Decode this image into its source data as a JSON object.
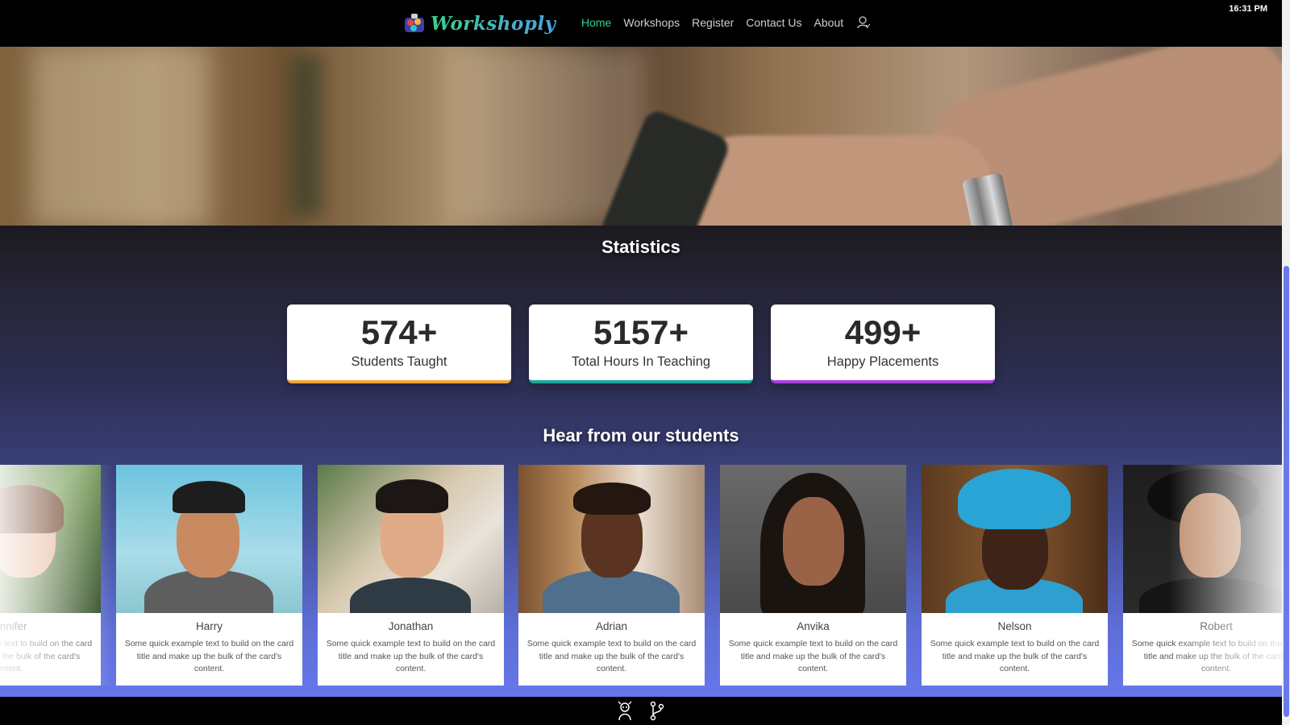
{
  "clock": "16:31 PM",
  "brand": {
    "name": "Workshoply",
    "logo_icon": "paint-palette-icon"
  },
  "nav": {
    "items": [
      {
        "label": "Home",
        "active": true
      },
      {
        "label": "Workshops",
        "active": false
      },
      {
        "label": "Register",
        "active": false
      },
      {
        "label": "Contact Us",
        "active": false
      },
      {
        "label": "About",
        "active": false
      }
    ],
    "user_icon": "user-icon"
  },
  "statistics": {
    "title": "Statistics",
    "cards": [
      {
        "value": "574+",
        "label": "Students Taught",
        "accent": "#f2a437"
      },
      {
        "value": "5157+",
        "label": "Total Hours In Teaching",
        "accent": "#16a89c"
      },
      {
        "value": "499+",
        "label": "Happy Placements",
        "accent": "#a83de0"
      }
    ]
  },
  "testimonials": {
    "title": "Hear from our students",
    "cards": [
      {
        "name": "Jennifer",
        "text": "Some quick example text to build on the card title and make up the bulk of the card's content."
      },
      {
        "name": "Harry",
        "text": "Some quick example text to build on the card title and make up the bulk of the card's content."
      },
      {
        "name": "Jonathan",
        "text": "Some quick example text to build on the card title and make up the bulk of the card's content."
      },
      {
        "name": "Adrian",
        "text": "Some quick example text to build on the card title and make up the bulk of the card's content."
      },
      {
        "name": "Anvika",
        "text": "Some quick example text to build on the card title and make up the bulk of the card's content."
      },
      {
        "name": "Nelson",
        "text": "Some quick example text to build on the card title and make up the bulk of the card's content."
      },
      {
        "name": "Robert",
        "text": "Some quick example text to build on the card title and make up the bulk of the card's content."
      }
    ]
  },
  "footer": {
    "icons": [
      "mascot-icon",
      "git-branch-icon"
    ]
  },
  "colors": {
    "accent_green": "#2fd38f",
    "gradient_bottom": "#6677ec"
  }
}
